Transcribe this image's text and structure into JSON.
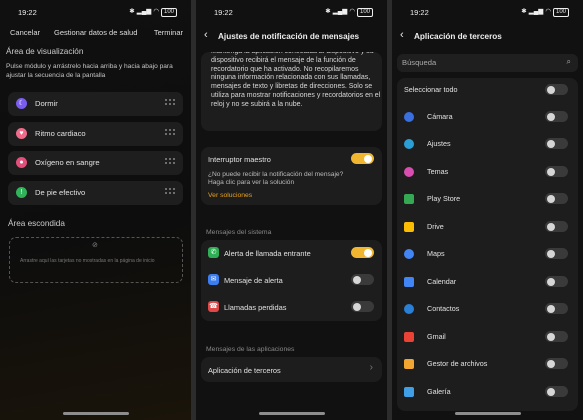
{
  "status": {
    "time": "19:22",
    "battery": "100"
  },
  "panel1": {
    "cancel": "Cancelar",
    "title": "Gestionar datos de salud",
    "finish": "Terminar",
    "section_visible": "Área de visualización",
    "hint": "Pulse módulo y arrástrelo hacia arriba y hacia abajo para ajustar la secuencia de la pantalla",
    "modules": [
      {
        "label": "Dormir",
        "icon": "moon-icon",
        "color": "#7a5cf0"
      },
      {
        "label": "Ritmo cardiaco",
        "icon": "heart-icon",
        "color": "#f06a8a"
      },
      {
        "label": "Oxígeno en sangre",
        "icon": "blood-oxygen-icon",
        "color": "#e0507a"
      },
      {
        "label": "De pie efectivo",
        "icon": "standing-icon",
        "color": "#31b35b"
      }
    ],
    "section_hidden": "Área escondida",
    "dropzone_text": "Arrastre aquí las tarjetas no mostradas en la página de inicio"
  },
  "panel2": {
    "title": "Ajustes de notificación de mensajes",
    "info": "Mantenga la aplicación conectada al dispositivo y su dispositivo recibirá el mensaje de la función de recordatorio que ha activado. No recopilaremos ninguna información relacionada con sus llamadas, mensajes de texto y libretas de direcciones. Solo se utiliza para mostrar notificaciones y recordatorios en el reloj y no se subirá a la nube.",
    "master_switch": "Interruptor maestro",
    "master_on": true,
    "problem_text": "¿No puede recibir la notificación del mensaje? Haga clic para ver la solución",
    "solutions_link": "Ver soluciones",
    "system_header": "Mensajes del sistema",
    "system_items": [
      {
        "label": "Alerta de llamada entrante",
        "icon": "phone-icon",
        "color": "#2fae55",
        "on": true
      },
      {
        "label": "Mensaje de alerta",
        "icon": "message-icon",
        "color": "#3c7ef0",
        "on": false
      },
      {
        "label": "Llamadas perdidas",
        "icon": "missed-call-icon",
        "color": "#e04848",
        "on": false
      }
    ],
    "apps_header": "Mensajes de las aplicaciones",
    "third_party": "Aplicación de terceros",
    "accent": "#f0b62f",
    "link_color": "#e8a21e"
  },
  "panel3": {
    "title": "Aplicación de terceros",
    "search_placeholder": "Búsqueda",
    "select_all": "Seleccionar todo",
    "apps": [
      {
        "label": "Cámara",
        "icon": "camera-icon",
        "color": "#3a6fe0"
      },
      {
        "label": "Ajustes",
        "icon": "gear-icon",
        "color": "#2a9fd6"
      },
      {
        "label": "Temas",
        "icon": "themes-icon",
        "color": "#d94cb0"
      },
      {
        "label": "Play Store",
        "icon": "play-store-icon",
        "color": "#34a853"
      },
      {
        "label": "Drive",
        "icon": "drive-icon",
        "color": "#fbbc04"
      },
      {
        "label": "Maps",
        "icon": "maps-icon",
        "color": "#4285f4"
      },
      {
        "label": "Calendar",
        "icon": "calendar-icon",
        "color": "#4285f4"
      },
      {
        "label": "Contactos",
        "icon": "contacts-icon",
        "color": "#2a7fd6"
      },
      {
        "label": "Gmail",
        "icon": "gmail-icon",
        "color": "#ea4335"
      },
      {
        "label": "Gestor de archivos",
        "icon": "file-manager-icon",
        "color": "#f2a531"
      },
      {
        "label": "Galería",
        "icon": "gallery-icon",
        "color": "#3fa0e8"
      }
    ]
  }
}
